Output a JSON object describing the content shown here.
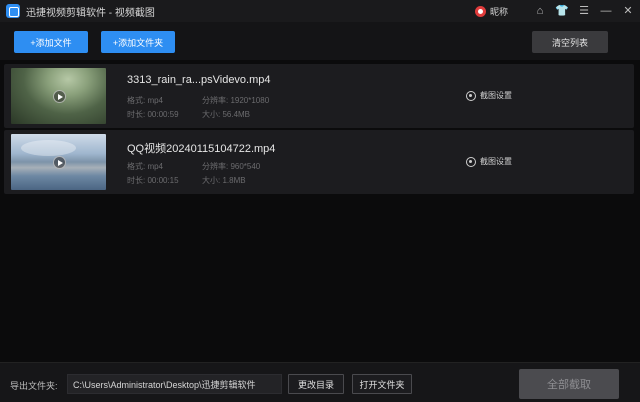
{
  "titlebar": {
    "title": "迅捷视频剪辑软件 - 视频截图",
    "user_name": "昵称",
    "icons": [
      "app-logo",
      "user-avatar-icon",
      "home-icon",
      "shirt-icon",
      "menu-icon",
      "minimize-icon",
      "close-icon"
    ]
  },
  "toolbar": {
    "add_file": "+添加文件",
    "add_folder": "+添加文件夹",
    "clear_list": "清空列表"
  },
  "files": [
    {
      "name": "3313_rain_ra...psVidevo.mp4",
      "format": "格式: mp4",
      "resolution": "分辨率: 1920*1080",
      "duration": "时长: 00:00:59",
      "size": "大小: 56.4MB",
      "settings_label": "截图设置"
    },
    {
      "name": "QQ视频20240115104722.mp4",
      "format": "格式: mp4",
      "resolution": "分辨率: 960*540",
      "duration": "时长: 00:00:15",
      "size": "大小: 1.8MB",
      "settings_label": "截图设置"
    }
  ],
  "footer": {
    "export_label": "导出文件夹:",
    "export_path": "C:\\Users\\Administrator\\Desktop\\迅捷剪辑软件",
    "change_dir": "更改目录",
    "open_folder": "打开文件夹",
    "capture_all": "全部截取"
  },
  "colors": {
    "accent": "#2e8ef2",
    "background": "#0b0b0c",
    "row_background": "#1c1c1f",
    "disabled_button": "#4b4b4f"
  }
}
